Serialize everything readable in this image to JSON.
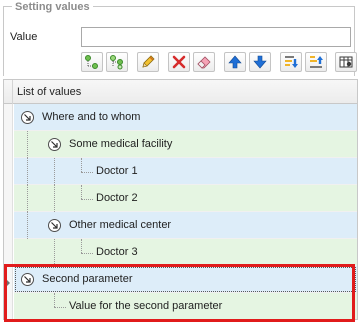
{
  "group": {
    "title": "Setting values"
  },
  "value_field": {
    "label": "Value",
    "value": ""
  },
  "toolbar": {
    "buttons": [
      {
        "icon": "add-node-icon"
      },
      {
        "icon": "add-child-node-icon"
      },
      {
        "icon": "edit-pencil-icon"
      },
      {
        "icon": "delete-icon",
        "color": "#d62b2b"
      },
      {
        "icon": "eraser-icon"
      },
      {
        "icon": "move-up-icon",
        "color": "#1f6fd6"
      },
      {
        "icon": "move-down-icon",
        "color": "#1f6fd6"
      },
      {
        "icon": "sort-ascending-icon"
      },
      {
        "icon": "sort-descending-icon"
      },
      {
        "icon": "settings-icon"
      }
    ]
  },
  "grid": {
    "header": "List of values",
    "rows": [
      {
        "label": "Where and to whom",
        "level": 0,
        "expandable": true,
        "color": "blue"
      },
      {
        "label": "Some medical facility",
        "level": 1,
        "expandable": true,
        "color": "green"
      },
      {
        "label": "Doctor 1",
        "level": 2,
        "expandable": false,
        "color": "blue"
      },
      {
        "label": "Doctor 2",
        "level": 2,
        "expandable": false,
        "color": "green"
      },
      {
        "label": "Other medical center",
        "level": 1,
        "expandable": true,
        "color": "blue"
      },
      {
        "label": "Doctor 3",
        "level": 2,
        "expandable": false,
        "color": "green"
      },
      {
        "label": "Second parameter",
        "level": 0,
        "expandable": true,
        "color": "blue",
        "selected": true
      },
      {
        "label": "Value for the second parameter",
        "level": 1,
        "expandable": false,
        "color": "green"
      }
    ]
  },
  "colors": {
    "row_blue": "#ddedf9",
    "row_green": "#e5f5e2",
    "highlight": "#e11b1b"
  }
}
